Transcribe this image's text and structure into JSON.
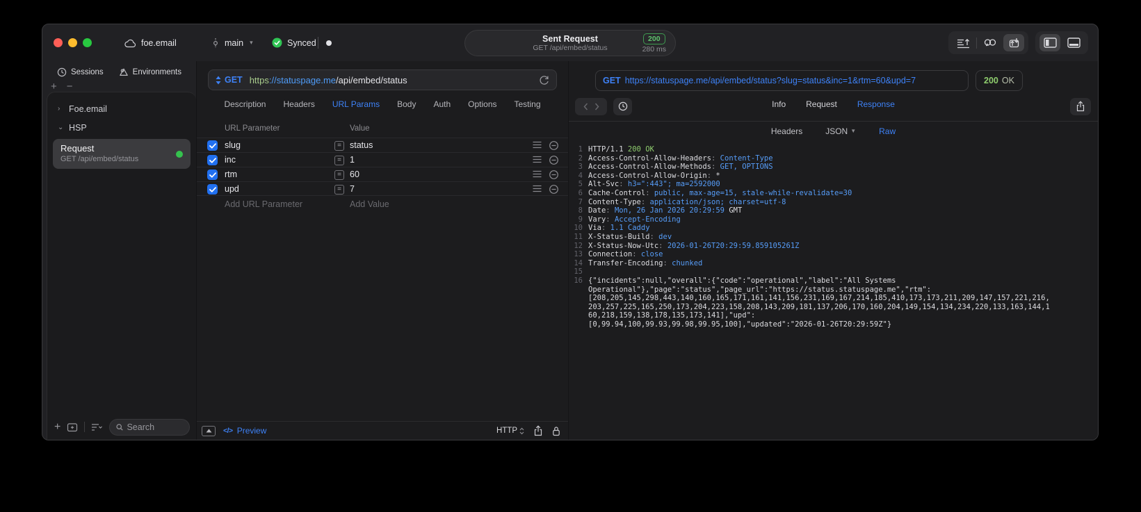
{
  "titlebar": {
    "project": "foe.email",
    "branch": "main",
    "sync_label": "Synced",
    "request": {
      "title": "Sent Request",
      "subtitle": "GET /api/embed/status",
      "status": "200",
      "duration": "280 ms"
    }
  },
  "sidebar": {
    "tabs": {
      "sessions": "Sessions",
      "environments": "Environments"
    },
    "tree": {
      "group1": "Foe.email",
      "group2": "HSP"
    },
    "request": {
      "name": "Request",
      "detail": "GET /api/embed/status"
    },
    "search_placeholder": "Search"
  },
  "request_panel": {
    "method": "GET",
    "url": {
      "scheme": "https",
      "host": "://statuspage.me",
      "path": "/api/embed/status"
    },
    "tabs": [
      "Description",
      "Headers",
      "URL Params",
      "Body",
      "Auth",
      "Options",
      "Testing"
    ],
    "active_tab": "URL Params",
    "table": {
      "col_param": "URL Parameter",
      "col_value": "Value",
      "rows": [
        {
          "enabled": true,
          "name": "slug",
          "value": "status"
        },
        {
          "enabled": true,
          "name": "inc",
          "value": "1"
        },
        {
          "enabled": true,
          "name": "rtm",
          "value": "60"
        },
        {
          "enabled": true,
          "name": "upd",
          "value": "7"
        }
      ],
      "add_param": "Add URL Parameter",
      "add_value": "Add Value"
    },
    "footer": {
      "code_glyph": "</>",
      "preview": "Preview",
      "protocol": "HTTP"
    }
  },
  "response_panel": {
    "request_line": {
      "method": "GET",
      "url": "https://statuspage.me/api/embed/status?slug=status&inc=1&rtm=60&upd=7"
    },
    "status": {
      "code": "200",
      "text": "OK"
    },
    "tabs": [
      "Info",
      "Request",
      "Response"
    ],
    "active_tab": "Response",
    "subtabs": [
      "Headers",
      "JSON",
      "Raw"
    ],
    "active_subtab": "Raw",
    "lines": [
      {
        "n": "1",
        "seg": [
          {
            "t": "HTTP/1.1 ",
            "c": "w"
          },
          {
            "t": "200 OK",
            "c": "g"
          }
        ]
      },
      {
        "n": "2",
        "seg": [
          {
            "t": "Access-Control-Allow-Headers",
            "c": "w"
          },
          {
            "t": ": ",
            "c": "d"
          },
          {
            "t": "Content-Type",
            "c": "b"
          }
        ]
      },
      {
        "n": "3",
        "seg": [
          {
            "t": "Access-Control-Allow-Methods",
            "c": "w"
          },
          {
            "t": ": ",
            "c": "d"
          },
          {
            "t": "GET, OPTIONS",
            "c": "b"
          }
        ]
      },
      {
        "n": "4",
        "seg": [
          {
            "t": "Access-Control-Allow-Origin",
            "c": "w"
          },
          {
            "t": ": ",
            "c": "d"
          },
          {
            "t": "*",
            "c": "w"
          }
        ]
      },
      {
        "n": "5",
        "seg": [
          {
            "t": "Alt-Svc",
            "c": "w"
          },
          {
            "t": ": ",
            "c": "d"
          },
          {
            "t": "h3=\":443\"; ma=2592000",
            "c": "b"
          }
        ]
      },
      {
        "n": "6",
        "seg": [
          {
            "t": "Cache-Control",
            "c": "w"
          },
          {
            "t": ": ",
            "c": "d"
          },
          {
            "t": "public, max-age=15, stale-while-revalidate=30",
            "c": "b"
          }
        ]
      },
      {
        "n": "7",
        "seg": [
          {
            "t": "Content-Type",
            "c": "w"
          },
          {
            "t": ": ",
            "c": "d"
          },
          {
            "t": "application/json; charset=utf-8",
            "c": "b"
          }
        ]
      },
      {
        "n": "8",
        "seg": [
          {
            "t": "Date",
            "c": "w"
          },
          {
            "t": ": ",
            "c": "d"
          },
          {
            "t": "Mon, 26 Jan 2026 20:29:59 ",
            "c": "b"
          },
          {
            "t": "GMT",
            "c": "w"
          }
        ]
      },
      {
        "n": "9",
        "seg": [
          {
            "t": "Vary",
            "c": "w"
          },
          {
            "t": ": ",
            "c": "d"
          },
          {
            "t": "Accept-Encoding",
            "c": "b"
          }
        ]
      },
      {
        "n": "10",
        "seg": [
          {
            "t": "Via",
            "c": "w"
          },
          {
            "t": ": ",
            "c": "d"
          },
          {
            "t": "1.1 Caddy",
            "c": "b"
          }
        ]
      },
      {
        "n": "11",
        "seg": [
          {
            "t": "X-Status-Build",
            "c": "w"
          },
          {
            "t": ": ",
            "c": "d"
          },
          {
            "t": "dev",
            "c": "b"
          }
        ]
      },
      {
        "n": "12",
        "seg": [
          {
            "t": "X-Status-Now-Utc",
            "c": "w"
          },
          {
            "t": ": ",
            "c": "d"
          },
          {
            "t": "2026-01-26T20:29:59.859105261Z",
            "c": "b"
          }
        ]
      },
      {
        "n": "13",
        "seg": [
          {
            "t": "Connection",
            "c": "w"
          },
          {
            "t": ": ",
            "c": "d"
          },
          {
            "t": "close",
            "c": "b"
          }
        ]
      },
      {
        "n": "14",
        "seg": [
          {
            "t": "Transfer-Encoding",
            "c": "w"
          },
          {
            "t": ": ",
            "c": "d"
          },
          {
            "t": "chunked",
            "c": "b"
          }
        ]
      },
      {
        "n": "15",
        "seg": []
      },
      {
        "n": "16",
        "seg": [
          {
            "t": "{\"incidents\":null,\"overall\":{\"code\":\"operational\",\"label\":\"All Systems",
            "c": "w"
          }
        ]
      },
      {
        "n": "",
        "seg": [
          {
            "t": "Operational\"},\"page\":\"status\",\"page_url\":\"https://status.statuspage.me\",\"rtm\":",
            "c": "w"
          }
        ]
      },
      {
        "n": "",
        "seg": [
          {
            "t": "[208,205,145,298,443,140,160,165,171,161,141,156,231,169,167,214,185,410,173,173,211,209,147,157,221,216,",
            "c": "w"
          }
        ]
      },
      {
        "n": "",
        "seg": [
          {
            "t": "203,257,225,165,250,173,204,223,158,208,143,209,181,137,206,170,160,204,149,154,134,234,220,133,163,144,1",
            "c": "w"
          }
        ]
      },
      {
        "n": "",
        "seg": [
          {
            "t": "60,218,159,138,178,135,173,141],\"upd\":",
            "c": "w"
          }
        ]
      },
      {
        "n": "",
        "seg": [
          {
            "t": "[0,99.94,100,99.93,99.98,99.95,100],\"updated\":\"2026-01-26T20:29:59Z\"}",
            "c": "w"
          }
        ]
      }
    ]
  },
  "colors": {
    "accent": "#3e82f7",
    "sync_green": "#30c554",
    "status_green": "#8fcd6e",
    "checkbox_blue": "#2170f0",
    "record_dot_green": "#35c24e"
  }
}
